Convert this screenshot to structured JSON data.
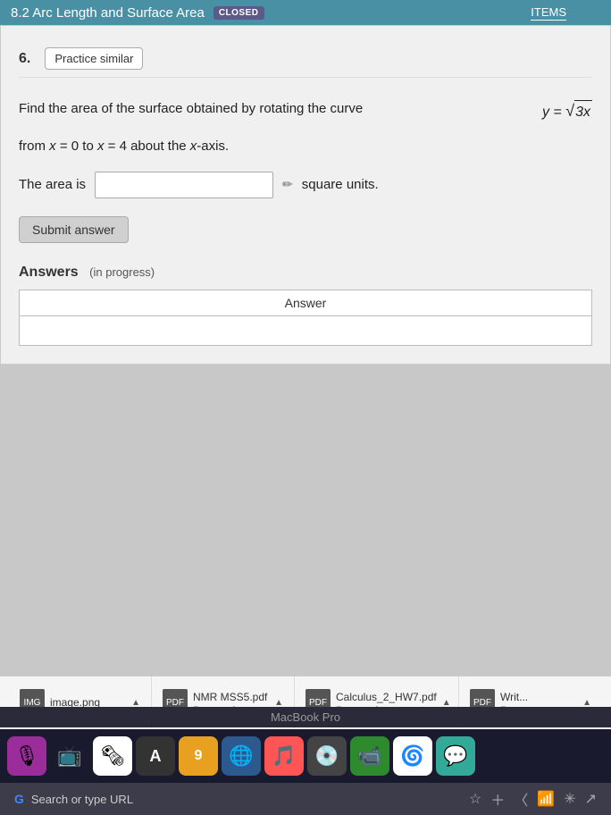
{
  "header": {
    "title": "8.2 Arc Length and Surface Area",
    "closed_badge": "CLOSED",
    "items_label": "ITEMS"
  },
  "question": {
    "number": "6.",
    "practice_similar_label": "Practice similar",
    "question_text": "Find the area of the surface obtained by rotating the curve",
    "equation": "y = √3x",
    "from_text": "from x = 0 to x = 4 about the x-axis.",
    "area_label": "The area is",
    "square_units": "square units.",
    "submit_label": "Submit answer",
    "answers_header": "Answers",
    "in_progress": "(in progress)",
    "table_header": "Answer"
  },
  "downloads": [
    {
      "name": "image.png",
      "status": "",
      "icon": "IMG"
    },
    {
      "name": "NMR MSS5.pdf",
      "status": "Removed",
      "icon": "PDF"
    },
    {
      "name": "Calculus_2_HW7.pdf",
      "status": "Removed",
      "icon": "PDF"
    },
    {
      "name": "Writ...",
      "status": "Remo...",
      "icon": "PDF"
    }
  ],
  "chrome": {
    "search_placeholder": "Search or type URL",
    "google_icon": "G"
  },
  "macbook_label": "MacBook Pro"
}
